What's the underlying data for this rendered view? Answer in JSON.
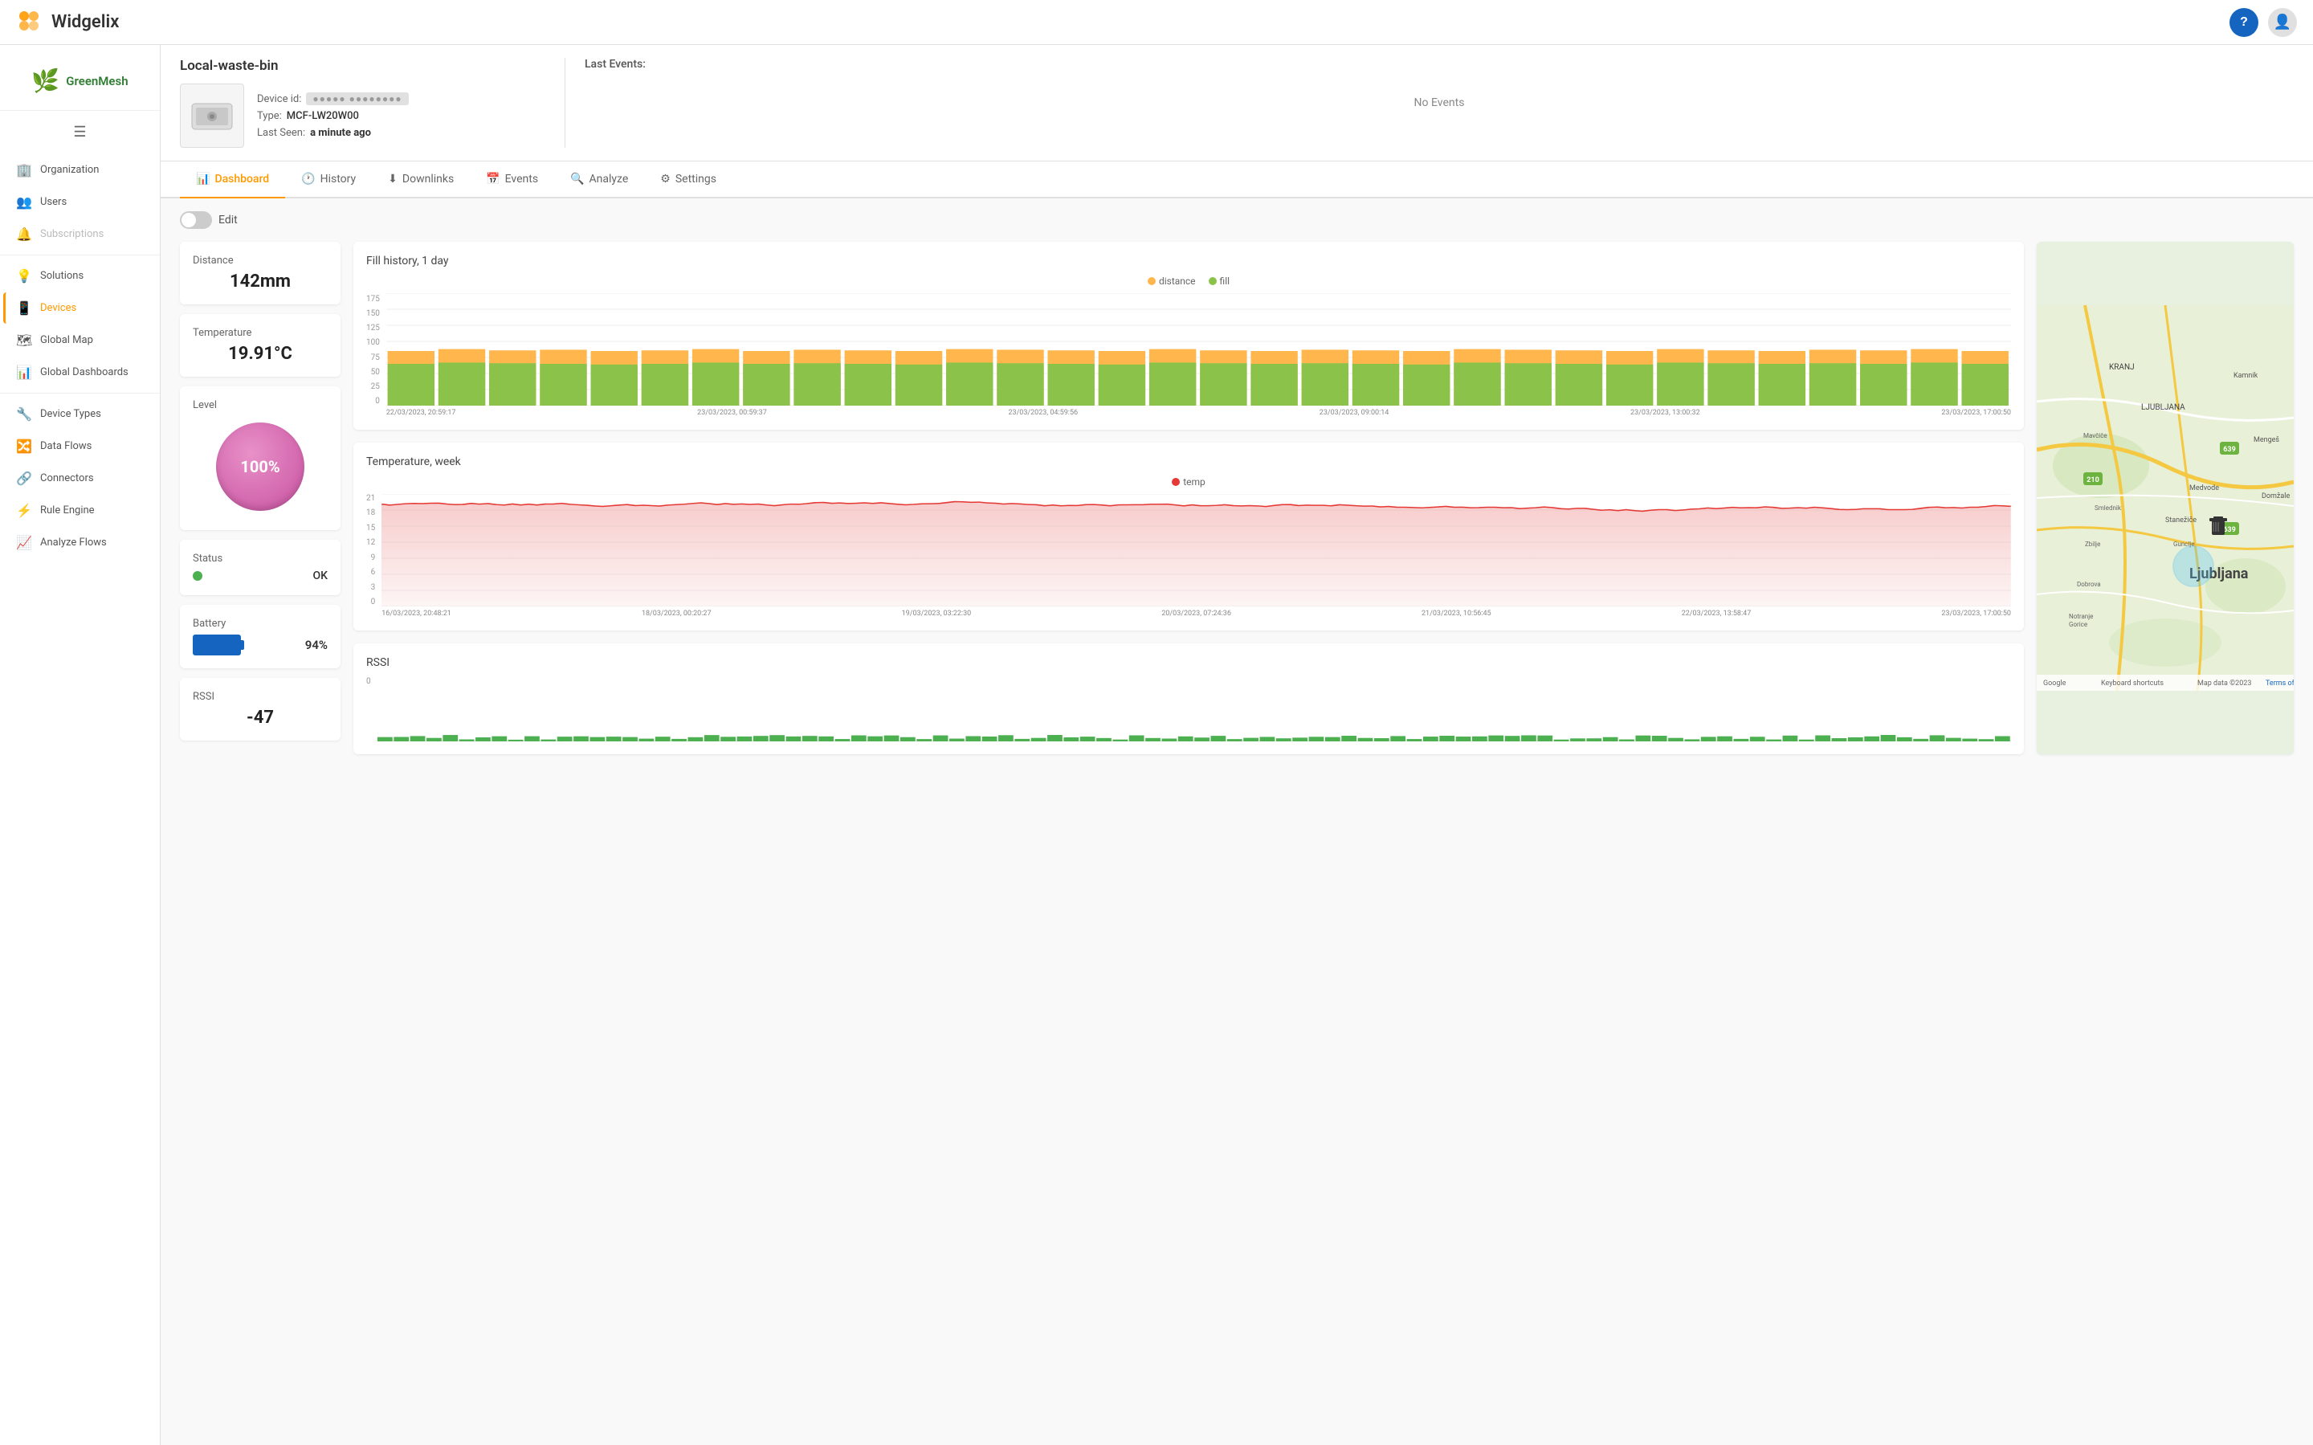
{
  "app": {
    "name": "Widgelix",
    "logo_letter": "W"
  },
  "header": {
    "help_label": "?",
    "user_icon": "👤"
  },
  "sidebar": {
    "hamburger": "☰",
    "brand": "GreenMesh",
    "items": [
      {
        "id": "organization",
        "label": "Organization",
        "icon": "🏢",
        "active": false,
        "disabled": false
      },
      {
        "id": "users",
        "label": "Users",
        "icon": "👥",
        "active": false,
        "disabled": false
      },
      {
        "id": "subscriptions",
        "label": "Subscriptions",
        "icon": "🔔",
        "active": false,
        "disabled": true
      },
      {
        "id": "divider1",
        "type": "divider"
      },
      {
        "id": "solutions",
        "label": "Solutions",
        "icon": "💡",
        "active": false,
        "disabled": false
      },
      {
        "id": "devices",
        "label": "Devices",
        "icon": "📱",
        "active": true,
        "disabled": false
      },
      {
        "id": "global-map",
        "label": "Global Map",
        "icon": "🗺",
        "active": false,
        "disabled": false
      },
      {
        "id": "global-dashboards",
        "label": "Global Dashboards",
        "icon": "📊",
        "active": false,
        "disabled": false
      },
      {
        "id": "divider2",
        "type": "divider"
      },
      {
        "id": "device-types",
        "label": "Device Types",
        "icon": "🔧",
        "active": false,
        "disabled": false
      },
      {
        "id": "data-flows",
        "label": "Data Flows",
        "icon": "🔀",
        "active": false,
        "disabled": false
      },
      {
        "id": "connectors",
        "label": "Connectors",
        "icon": "🔗",
        "active": false,
        "disabled": false
      },
      {
        "id": "rule-engine",
        "label": "Rule Engine",
        "icon": "⚡",
        "active": false,
        "disabled": false
      },
      {
        "id": "analyze-flows",
        "label": "Analyze Flows",
        "icon": "📈",
        "active": false,
        "disabled": false
      }
    ]
  },
  "device": {
    "name": "Local-waste-bin",
    "id_label": "Device id:",
    "id_masked": "●●●●●  ●●●●●●●●",
    "type_label": "Type:",
    "type_value": "MCF-LW20W00",
    "last_seen_label": "Last Seen:",
    "last_seen_value": "a minute ago"
  },
  "last_events": {
    "title": "Last Events:",
    "no_events": "No Events"
  },
  "tabs": [
    {
      "id": "dashboard",
      "label": "Dashboard",
      "icon": "📊",
      "active": true
    },
    {
      "id": "history",
      "label": "History",
      "icon": "🕐",
      "active": false
    },
    {
      "id": "downlinks",
      "label": "Downlinks",
      "icon": "⬇",
      "active": false
    },
    {
      "id": "events",
      "label": "Events",
      "icon": "📅",
      "active": false
    },
    {
      "id": "analyze",
      "label": "Analyze",
      "icon": "🔍",
      "active": false
    },
    {
      "id": "settings",
      "label": "Settings",
      "icon": "⚙",
      "active": false
    }
  ],
  "edit_toggle": {
    "label": "Edit",
    "enabled": false
  },
  "widgets": {
    "distance": {
      "label": "Distance",
      "value": "142",
      "unit": "mm"
    },
    "temperature": {
      "label": "Temperature",
      "value": "19.91",
      "unit": "°C"
    },
    "level": {
      "label": "Level",
      "value": "100%"
    },
    "status": {
      "label": "Status",
      "value": "OK",
      "dot_color": "#4caf50"
    },
    "battery": {
      "label": "Battery",
      "value": "94%"
    },
    "rssi": {
      "label": "RSSI",
      "value": "-47"
    }
  },
  "fill_chart": {
    "title": "Fill history, 1 day",
    "legend_distance": "distance",
    "legend_fill": "fill",
    "x_labels": [
      "22/03/2023, 20:59:17",
      "23/03/2023, 00:59:37",
      "23/03/2023, 04:59:56",
      "23/03/2023, 09:00:14",
      "23/03/2023, 13:00:32",
      "23/03/2023, 17:00:50"
    ],
    "y_labels": [
      "175",
      "150",
      "125",
      "100",
      "75",
      "50",
      "25",
      "0"
    ],
    "bars": [
      {
        "dist": 85,
        "fill": 65
      },
      {
        "dist": 88,
        "fill": 67
      },
      {
        "dist": 86,
        "fill": 66
      },
      {
        "dist": 87,
        "fill": 65
      },
      {
        "dist": 85,
        "fill": 64
      },
      {
        "dist": 86,
        "fill": 65
      },
      {
        "dist": 88,
        "fill": 67
      },
      {
        "dist": 85,
        "fill": 65
      },
      {
        "dist": 87,
        "fill": 66
      },
      {
        "dist": 86,
        "fill": 65
      },
      {
        "dist": 85,
        "fill": 64
      },
      {
        "dist": 88,
        "fill": 67
      },
      {
        "dist": 87,
        "fill": 66
      },
      {
        "dist": 86,
        "fill": 65
      },
      {
        "dist": 85,
        "fill": 64
      },
      {
        "dist": 88,
        "fill": 67
      },
      {
        "dist": 86,
        "fill": 66
      },
      {
        "dist": 85,
        "fill": 65
      },
      {
        "dist": 87,
        "fill": 66
      },
      {
        "dist": 86,
        "fill": 65
      },
      {
        "dist": 85,
        "fill": 64
      },
      {
        "dist": 88,
        "fill": 67
      },
      {
        "dist": 87,
        "fill": 66
      },
      {
        "dist": 86,
        "fill": 65
      },
      {
        "dist": 85,
        "fill": 64
      },
      {
        "dist": 88,
        "fill": 67
      },
      {
        "dist": 86,
        "fill": 66
      },
      {
        "dist": 85,
        "fill": 65
      },
      {
        "dist": 87,
        "fill": 66
      },
      {
        "dist": 86,
        "fill": 65
      },
      {
        "dist": 88,
        "fill": 67
      },
      {
        "dist": 85,
        "fill": 65
      }
    ]
  },
  "temp_chart": {
    "title": "Temperature, week",
    "legend_temp": "temp",
    "x_labels": [
      "16/03/2023, 20:48:21",
      "18/03/2023, 00:20:27",
      "19/03/2023, 03:22:30",
      "20/03/2023, 07:24:36",
      "21/03/2023, 10:56:45",
      "22/03/2023, 13:58:47",
      "23/03/2023, 17:00:50"
    ],
    "y_labels": [
      "21",
      "18",
      "15",
      "12",
      "9",
      "6",
      "3",
      "0"
    ]
  },
  "rssi_chart": {
    "title": "RSSI",
    "x_labels": [
      ""
    ],
    "y_labels": [
      "0"
    ]
  },
  "map": {
    "city": "Ljubljana",
    "credit": "Google",
    "map_data": "Map data ©2023",
    "terms": "Terms of Use",
    "keyboard_shortcuts": "Keyboard shortcuts"
  }
}
